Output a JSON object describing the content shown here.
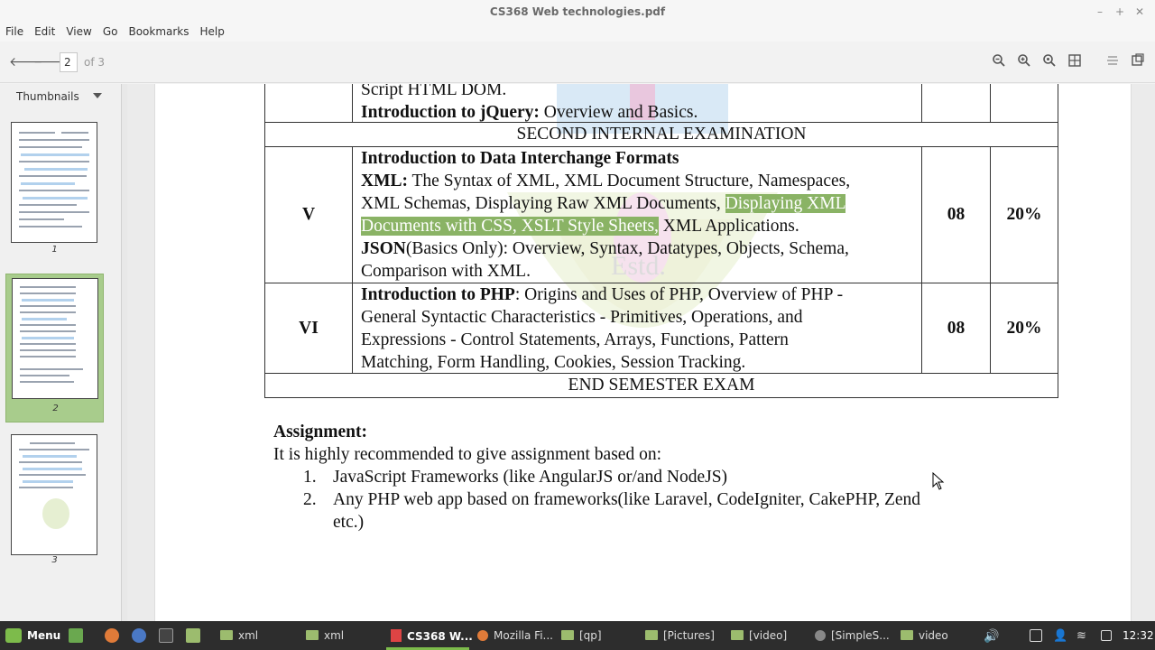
{
  "window": {
    "title": "CS368 Web technologies.pdf"
  },
  "menu": {
    "items": [
      "File",
      "Edit",
      "View",
      "Go",
      "Bookmarks",
      "Help"
    ]
  },
  "toolbar": {
    "current_page": "2",
    "page_total": "of 3"
  },
  "sidebar": {
    "mode": "Thumbnails",
    "thumbnails": [
      {
        "label": "1"
      },
      {
        "label": "2"
      },
      {
        "label": "3"
      }
    ]
  },
  "document": {
    "row_top": {
      "line1": "Script HTML DOM.",
      "line2_bold": "Introduction to jQuery:",
      "line2_rest": " Overview and Basics."
    },
    "second_internal": "SECOND INTERNAL EXAMINATION",
    "module_v": {
      "num": "V",
      "hours": "08",
      "percent": "20%",
      "heading": "Introduction to Data Interchange Formats",
      "xml_bold": "XML:",
      "xml_l1": " The Syntax of XML, XML Document Structure, Namespaces,",
      "xml_l2_plain": "XML Schemas, Displaying Raw XML Documents, ",
      "xml_l2_hl": "Displaying XML",
      "xml_l3_hl": "Documents with CSS, XSLT Style Sheets,",
      "xml_l3_plain": " XML Applications.",
      "json_bold": "JSON",
      "json_l1": "(Basics Only): Overview, Syntax, Datatypes, Objects, Schema,",
      "json_l2": "Comparison with XML."
    },
    "module_vi": {
      "num": "VI",
      "hours": "08",
      "percent": "20%",
      "php_bold": "Introduction to PHP",
      "l1": ": Origins and Uses of PHP, Overview of PHP -",
      "l2": "General Syntactic Characteristics - Primitives, Operations, and",
      "l3": "Expressions - Control Statements, Arrays, Functions, Pattern",
      "l4": "Matching, Form Handling, Cookies, Session Tracking."
    },
    "end_semester": "END SEMESTER EXAM",
    "assignment": {
      "heading": "Assignment:",
      "intro": "It is highly recommended to give assignment based on:",
      "items": [
        {
          "num": "1.",
          "text": "JavaScript Frameworks (like AngularJS or/and NodeJS)"
        },
        {
          "num": "2.",
          "text": "Any PHP web app based on frameworks(like Laravel, CodeIgniter, CakePHP, Zend",
          "cont": "etc.)"
        }
      ]
    },
    "watermark_text": "Estd."
  },
  "taskbar": {
    "menu_label": "Menu",
    "tasks": [
      {
        "label": "xml"
      },
      {
        "label": "xml"
      },
      {
        "label": "CS368 W..."
      },
      {
        "label": "Mozilla Fi..."
      },
      {
        "label": "[qp]"
      },
      {
        "label": "[Pictures]"
      },
      {
        "label": "[video]"
      },
      {
        "label": "[SimpleS..."
      },
      {
        "label": "video"
      }
    ],
    "clock": "12:32"
  },
  "colors": {
    "highlight": "#8ab365",
    "active_thumb": "#a8cc8c",
    "taskbar": "#2d2d2d"
  }
}
